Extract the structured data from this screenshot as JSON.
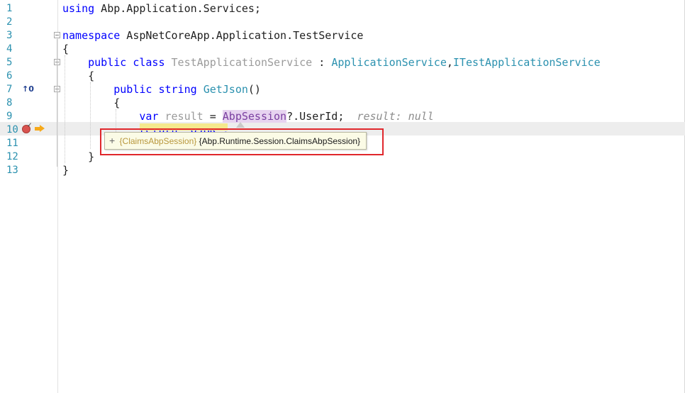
{
  "editor": {
    "lines": [
      {
        "n": "1",
        "tokens": [
          {
            "t": "using",
            "c": "kw"
          },
          {
            "t": " Abp.Application.Services;",
            "c": "id"
          }
        ]
      },
      {
        "n": "2",
        "tokens": []
      },
      {
        "n": "3",
        "tokens": [
          {
            "t": "namespace",
            "c": "kw"
          },
          {
            "t": " AspNetCoreApp.Application.TestService",
            "c": "id"
          }
        ]
      },
      {
        "n": "4",
        "tokens": [
          {
            "t": "{",
            "c": "id"
          }
        ]
      },
      {
        "n": "5",
        "tokens": [
          {
            "t": "    public class ",
            "c": "kw"
          },
          {
            "t": "TestApplicationService",
            "c": "gray"
          },
          {
            "t": " : ",
            "c": "id"
          },
          {
            "t": "ApplicationService",
            "c": "ty"
          },
          {
            "t": ",",
            "c": "id"
          },
          {
            "t": "ITestApplicationService",
            "c": "ty"
          }
        ]
      },
      {
        "n": "6",
        "tokens": [
          {
            "t": "    {",
            "c": "id"
          }
        ]
      },
      {
        "n": "7",
        "tokens": [
          {
            "t": "        public string ",
            "c": "kw"
          },
          {
            "t": "GetJson",
            "c": "ty"
          },
          {
            "t": "()",
            "c": "id"
          }
        ]
      },
      {
        "n": "8",
        "tokens": [
          {
            "t": "        {",
            "c": "id"
          }
        ]
      },
      {
        "n": "9",
        "tokens": [
          {
            "t": "            var ",
            "c": "kw"
          },
          {
            "t": "result",
            "c": "gray"
          },
          {
            "t": " = ",
            "c": "id"
          },
          {
            "t": "AbpSession",
            "c": "purp abp-hl"
          },
          {
            "t": "?.UserId;",
            "c": "id"
          },
          {
            "t": "  result: null",
            "c": "hint"
          }
        ]
      },
      {
        "n": "10",
        "tokens": [
          {
            "t": "            return \"OJBK\";",
            "c": "kw"
          }
        ]
      },
      {
        "n": "11",
        "tokens": [
          {
            "t": "        }",
            "c": "id"
          }
        ]
      },
      {
        "n": "12",
        "tokens": [
          {
            "t": "    }",
            "c": "id"
          }
        ]
      },
      {
        "n": "13",
        "tokens": [
          {
            "t": "}",
            "c": "id"
          }
        ]
      }
    ]
  },
  "codelens": {
    "label": "↑0"
  },
  "tooltip": {
    "expand_symbol": "+",
    "name": "{ClaimsAbpSession}",
    "value": "{Abp.Runtime.Session.ClaimsAbpSession}"
  },
  "colors": {
    "line_number": "#2b91af",
    "keyword": "#0000ff",
    "type": "#2b91af",
    "breakpoint": "#d9534f",
    "execution_arrow": "#f6a91a",
    "highlight_frame": "#e0272c"
  }
}
